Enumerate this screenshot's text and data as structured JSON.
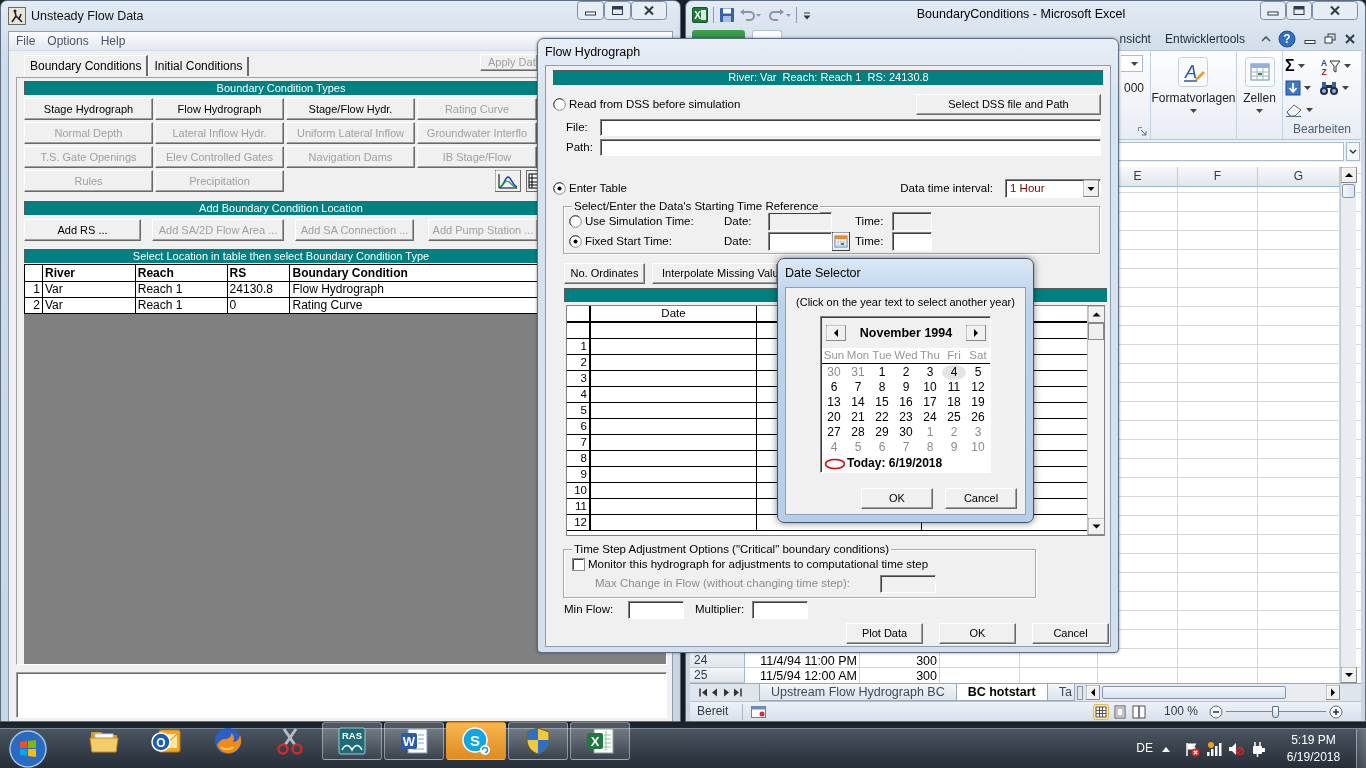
{
  "main_window": {
    "title": "Unsteady Flow Data",
    "menu": [
      "File",
      "Options",
      "Help"
    ],
    "tabs": [
      {
        "label": "Boundary Conditions",
        "selected": true
      },
      {
        "label": "Initial Conditions",
        "selected": false
      }
    ],
    "apply_button": {
      "label": "Apply Dat",
      "disabled": true
    },
    "types_header": "Boundary Condition Types",
    "type_buttons": [
      {
        "label": "Stage Hydrograph",
        "disabled": false
      },
      {
        "label": "Flow Hydrograph",
        "disabled": false
      },
      {
        "label": "Stage/Flow Hydr.",
        "disabled": false
      },
      {
        "label": "Rating Curve",
        "disabled": true
      },
      {
        "label": "Normal Depth",
        "disabled": true
      },
      {
        "label": "Lateral Inflow Hydr.",
        "disabled": true
      },
      {
        "label": "Uniform Lateral Inflow",
        "disabled": true
      },
      {
        "label": "Groundwater Interflo",
        "disabled": true
      },
      {
        "label": "T.S. Gate Openings",
        "disabled": true
      },
      {
        "label": "Elev Controlled Gates",
        "disabled": true
      },
      {
        "label": "Navigation Dams",
        "disabled": true
      },
      {
        "label": "IB Stage/Flow",
        "disabled": true
      },
      {
        "label": "Rules",
        "disabled": true
      },
      {
        "label": "Precipitation",
        "disabled": true
      }
    ],
    "location_header": "Add Boundary Condition Location",
    "location_buttons": [
      {
        "label": "Add RS ...",
        "disabled": false
      },
      {
        "label": "Add SA/2D Flow Area ...",
        "disabled": true
      },
      {
        "label": "Add SA Connection ...",
        "disabled": true
      },
      {
        "label": "Add Pump Station ...",
        "disabled": true
      }
    ],
    "table_header": "Select Location in table then select Boundary Condition Type",
    "table": {
      "columns": [
        "River",
        "Reach",
        "RS",
        "Boundary Condition"
      ],
      "rows": [
        {
          "number": "1",
          "cells": [
            "Var",
            "Reach 1",
            "24130.8",
            "Flow Hydrograph"
          ]
        },
        {
          "number": "2",
          "cells": [
            "Var",
            "Reach 1",
            "0",
            "Rating Curve"
          ]
        }
      ]
    }
  },
  "excel_window": {
    "title": "BoundaryConditions - Microsoft Excel",
    "logo_glyph": "X",
    "ribbon_tabs": [
      {
        "selected": true
      },
      {
        "label": "nsicht",
        "selected": false
      },
      {
        "label": "Entwicklertools",
        "selected": false
      }
    ],
    "help_glyph": "?",
    "number_fragment": "000",
    "styles_group": {
      "label": "Formatvorlagen",
      "glyph": "A"
    },
    "cells_group": {
      "label": "Zellen"
    },
    "editing_group": {
      "label": "Bearbeiten",
      "sum_glyph": "Σ",
      "sort_glyphs": [
        "A",
        "Z"
      ]
    },
    "column_headers": [
      "E",
      "F",
      "G"
    ],
    "rows": [
      {
        "number": "24",
        "cells": [
          "11/4/94 11:00 PM",
          "300"
        ]
      },
      {
        "number": "25",
        "cells": [
          "11/5/94 12:00 AM",
          "300"
        ]
      }
    ],
    "sheet_tabs": [
      {
        "label": "Upstream Flow Hydrograph BC",
        "selected": false
      },
      {
        "label": "BC hotstart",
        "selected": true
      },
      {
        "label": "Ta",
        "selected": false
      }
    ],
    "status": "Bereit",
    "view_buttons": [
      {
        "kind": "normal",
        "selected": true
      },
      {
        "kind": "layout",
        "selected": false
      },
      {
        "kind": "break",
        "selected": false
      }
    ],
    "zoom": "100 %",
    "zoom_slider": {
      "level": 0.5
    }
  },
  "flow_dialog": {
    "title": "Flow Hydrograph",
    "location": "River: Var  Reach: Reach 1  RS: 24130.8",
    "dss_option": {
      "label": "Read from DSS before simulation",
      "selected": false
    },
    "dss_button": "Select DSS file and Path",
    "file_label": "File:",
    "path_label": "Path:",
    "table_option": {
      "label": "Enter Table",
      "selected": true
    },
    "interval_label": "Data time interval:",
    "interval_value": "1 Hour",
    "time_reference": {
      "legend": "Select/Enter the Data's Starting Time Reference",
      "options": [
        {
          "kind": "simulation",
          "label": "Use Simulation Time:",
          "selected": false,
          "date_label": "Date:",
          "time_label": "Time:"
        },
        {
          "kind": "fixed",
          "label": "Fixed Start Time:",
          "selected": true,
          "date_label": "Date:",
          "time_label": "Time:"
        }
      ]
    },
    "buttons": [
      "No. Ordinates",
      "Interpolate Missing Valu"
    ],
    "table": {
      "columns": [
        "Date"
      ],
      "row_numbers": [
        "1",
        "2",
        "3",
        "4",
        "5",
        "6",
        "7",
        "8",
        "9",
        "10",
        "11",
        "12"
      ]
    },
    "time_step": {
      "legend": "Time Step Adjustment Options (\"Critical\" boundary conditions)",
      "monitor": {
        "label": "Monitor this hydrograph for adjustments to computational time step",
        "checked": false
      },
      "max_change": {
        "label": "Max Change in Flow (without changing time step):",
        "disabled": true
      }
    },
    "min_flow_label": "Min Flow:",
    "multiplier_label": "Multiplier:",
    "footer_buttons": [
      "Plot Data",
      "OK",
      "Cancel"
    ]
  },
  "date_selector": {
    "title": "Date Selector",
    "hint": "(Click on the year text to select another year)",
    "month": "November 1994",
    "weekdays": [
      "Sun",
      "Mon",
      "Tue",
      "Wed",
      "Thu",
      "Fri",
      "Sat"
    ],
    "days": [
      {
        "label": "30",
        "in_month": false,
        "selected": false
      },
      {
        "label": "31",
        "in_month": false,
        "selected": false
      },
      {
        "label": "1",
        "in_month": true,
        "selected": false
      },
      {
        "label": "2",
        "in_month": true,
        "selected": false
      },
      {
        "label": "3",
        "in_month": true,
        "selected": false
      },
      {
        "label": "4",
        "in_month": true,
        "selected": true
      },
      {
        "label": "5",
        "in_month": true,
        "selected": false
      },
      {
        "label": "6",
        "in_month": true,
        "selected": false
      },
      {
        "label": "7",
        "in_month": true,
        "selected": false
      },
      {
        "label": "8",
        "in_month": true,
        "selected": false
      },
      {
        "label": "9",
        "in_month": true,
        "selected": false
      },
      {
        "label": "10",
        "in_month": true,
        "selected": false
      },
      {
        "label": "11",
        "in_month": true,
        "selected": false
      },
      {
        "label": "12",
        "in_month": true,
        "selected": false
      },
      {
        "label": "13",
        "in_month": true,
        "selected": false
      },
      {
        "label": "14",
        "in_month": true,
        "selected": false
      },
      {
        "label": "15",
        "in_month": true,
        "selected": false
      },
      {
        "label": "16",
        "in_month": true,
        "selected": false
      },
      {
        "label": "17",
        "in_month": true,
        "selected": false
      },
      {
        "label": "18",
        "in_month": true,
        "selected": false
      },
      {
        "label": "19",
        "in_month": true,
        "selected": false
      },
      {
        "label": "20",
        "in_month": true,
        "selected": false
      },
      {
        "label": "21",
        "in_month": true,
        "selected": false
      },
      {
        "label": "22",
        "in_month": true,
        "selected": false
      },
      {
        "label": "23",
        "in_month": true,
        "selected": false
      },
      {
        "label": "24",
        "in_month": true,
        "selected": false
      },
      {
        "label": "25",
        "in_month": true,
        "selected": false
      },
      {
        "label": "26",
        "in_month": true,
        "selected": false
      },
      {
        "label": "27",
        "in_month": true,
        "selected": false
      },
      {
        "label": "28",
        "in_month": true,
        "selected": false
      },
      {
        "label": "29",
        "in_month": true,
        "selected": false
      },
      {
        "label": "30",
        "in_month": true,
        "selected": false
      },
      {
        "label": "1",
        "in_month": false,
        "selected": false
      },
      {
        "label": "2",
        "in_month": false,
        "selected": false
      },
      {
        "label": "3",
        "in_month": false,
        "selected": false
      },
      {
        "label": "4",
        "in_month": false,
        "selected": false
      },
      {
        "label": "5",
        "in_month": false,
        "selected": false
      },
      {
        "label": "6",
        "in_month": false,
        "selected": false
      },
      {
        "label": "7",
        "in_month": false,
        "selected": false
      },
      {
        "label": "8",
        "in_month": false,
        "selected": false
      },
      {
        "label": "9",
        "in_month": false,
        "selected": false
      },
      {
        "label": "10",
        "in_month": false,
        "selected": false
      }
    ],
    "today": "Today: 6/19/2018",
    "buttons": [
      "OK",
      "Cancel"
    ]
  },
  "taskbar": {
    "apps": [
      {
        "kind": "explorer",
        "running": false,
        "alert": false
      },
      {
        "kind": "outlook",
        "glyph": "O",
        "running": false,
        "alert": false
      },
      {
        "kind": "firefox",
        "running": false,
        "alert": false
      },
      {
        "kind": "snipping",
        "running": false,
        "alert": false
      },
      {
        "kind": "ras",
        "glyph": "RAS",
        "running": true,
        "alert": false
      },
      {
        "kind": "word",
        "glyph": "W",
        "running": true,
        "alert": false
      },
      {
        "kind": "skype",
        "glyph": "S",
        "running": false,
        "alert": true
      },
      {
        "kind": "shield",
        "running": true,
        "alert": false
      },
      {
        "kind": "excel",
        "glyph": "X",
        "running": true,
        "alert": false
      }
    ],
    "language": "DE",
    "time": "5:19 PM",
    "date": "6/19/2018"
  }
}
